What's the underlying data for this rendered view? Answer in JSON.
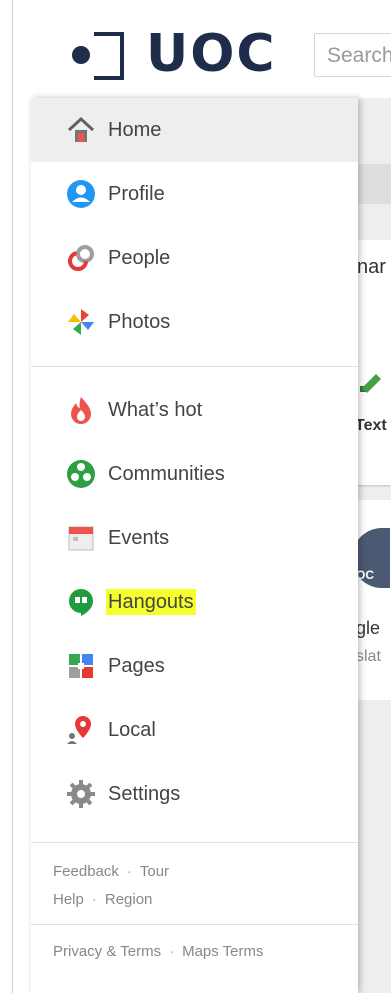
{
  "header": {
    "logo_text": "UOC",
    "search_placeholder": "Search"
  },
  "drawer": {
    "main_items": [
      {
        "label": "Home",
        "icon": "home-icon",
        "active": true
      },
      {
        "label": "Profile",
        "icon": "profile-icon"
      },
      {
        "label": "People",
        "icon": "people-icon"
      },
      {
        "label": "Photos",
        "icon": "photos-icon"
      }
    ],
    "secondary_items": [
      {
        "label": "What’s hot",
        "icon": "flame-icon"
      },
      {
        "label": "Communities",
        "icon": "communities-icon"
      },
      {
        "label": "Events",
        "icon": "calendar-icon"
      },
      {
        "label": "Hangouts",
        "icon": "hangouts-icon",
        "highlighted": true
      },
      {
        "label": "Pages",
        "icon": "pages-icon"
      },
      {
        "label": "Local",
        "icon": "location-pin-icon"
      },
      {
        "label": "Settings",
        "icon": "gear-icon"
      }
    ],
    "footer": {
      "feedback": "Feedback",
      "tour": "Tour",
      "help": "Help",
      "region": "Region",
      "privacy": "Privacy & Terms",
      "maps_terms": "Maps Terms",
      "separator": "·"
    }
  },
  "background": {
    "partial_title": "nar",
    "partial_text_button": "Text",
    "partial_avatar_text": "OC",
    "partial_name": "gle",
    "partial_sub": "slat"
  },
  "colors": {
    "logo": "#1f2c4b",
    "highlight": "#f4ff2b",
    "active_bg": "#eeeeee"
  }
}
